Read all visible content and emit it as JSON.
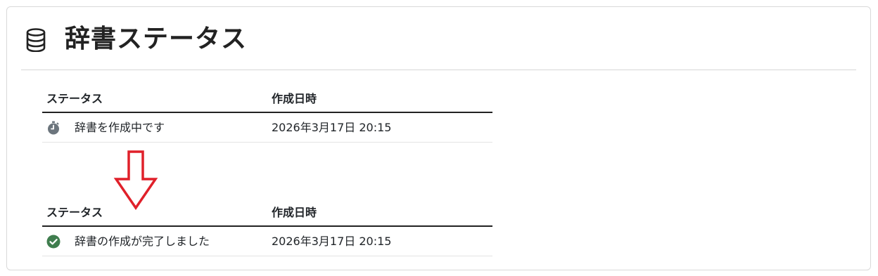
{
  "header": {
    "title": "辞書ステータス",
    "icon": "database-icon"
  },
  "before": {
    "columns": {
      "status": "ステータス",
      "created": "作成日時"
    },
    "rows": [
      {
        "status": "辞書を作成中です",
        "created": "2026年3月17日 20:15",
        "icon": "stopwatch-icon",
        "icon_color": "#6c757d"
      }
    ]
  },
  "after": {
    "columns": {
      "status": "ステータス",
      "created": "作成日時"
    },
    "rows": [
      {
        "status": "辞書の作成が完了しました",
        "created": "2026年3月17日 20:15",
        "icon": "check-circle-icon",
        "icon_color": "#3f7d4e"
      }
    ]
  },
  "annotation": {
    "arrow_icon": "down-arrow-icon",
    "arrow_color": "#e0202a"
  }
}
